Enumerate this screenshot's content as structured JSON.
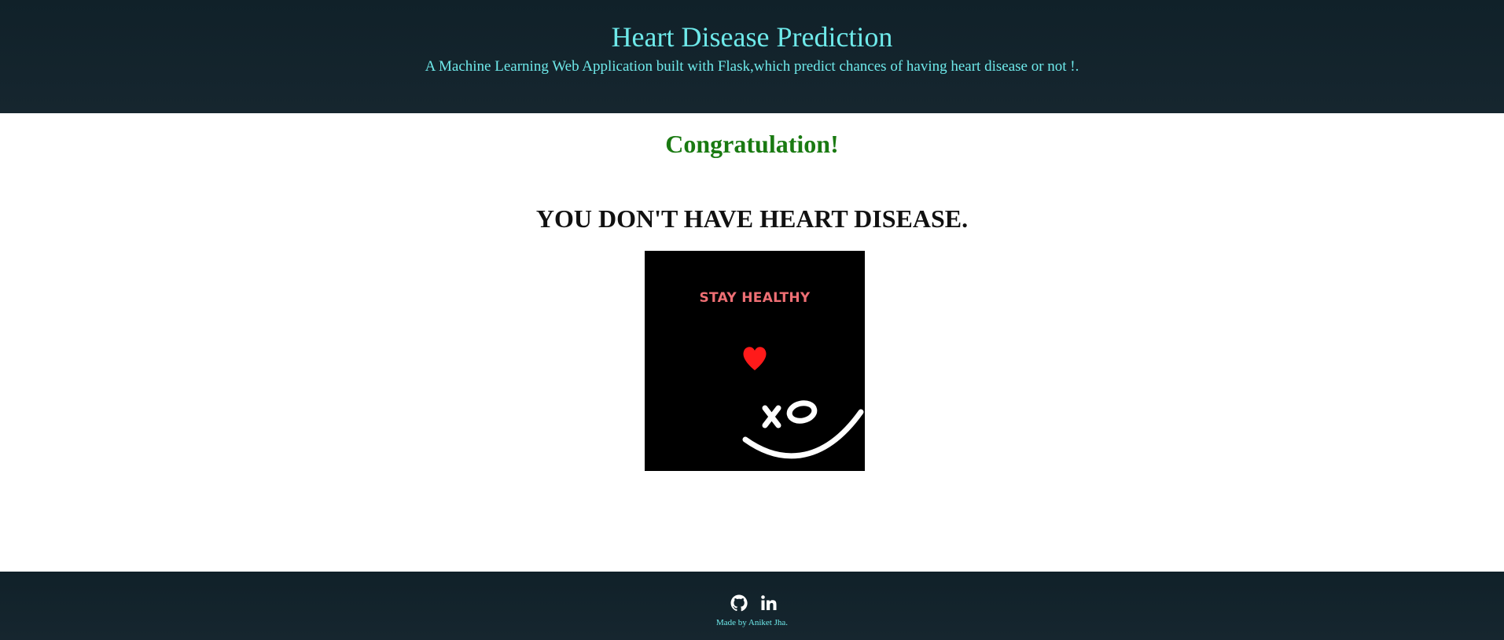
{
  "header": {
    "title": "Heart Disease Prediction",
    "subtitle": "A Machine Learning Web Application built with Flask,which predict chances of having heart disease or not !."
  },
  "main": {
    "congrats": "Congratulation!",
    "result": "YOU DON'T HAVE HEART DISEASE.",
    "image": {
      "caption": "STAY HEALTHY",
      "icons": [
        "heart-icon",
        "xo-smile-icon"
      ]
    }
  },
  "footer": {
    "icons": [
      "github-icon",
      "linkedin-icon"
    ],
    "credit": "Made by Aniket Jha."
  },
  "colors": {
    "header_bg": "#102129",
    "accent_cyan": "#6ee9ea",
    "congrats_green": "#1a7a12",
    "heart_red": "#ff1a1a",
    "caption_pink": "#ee6f74"
  }
}
